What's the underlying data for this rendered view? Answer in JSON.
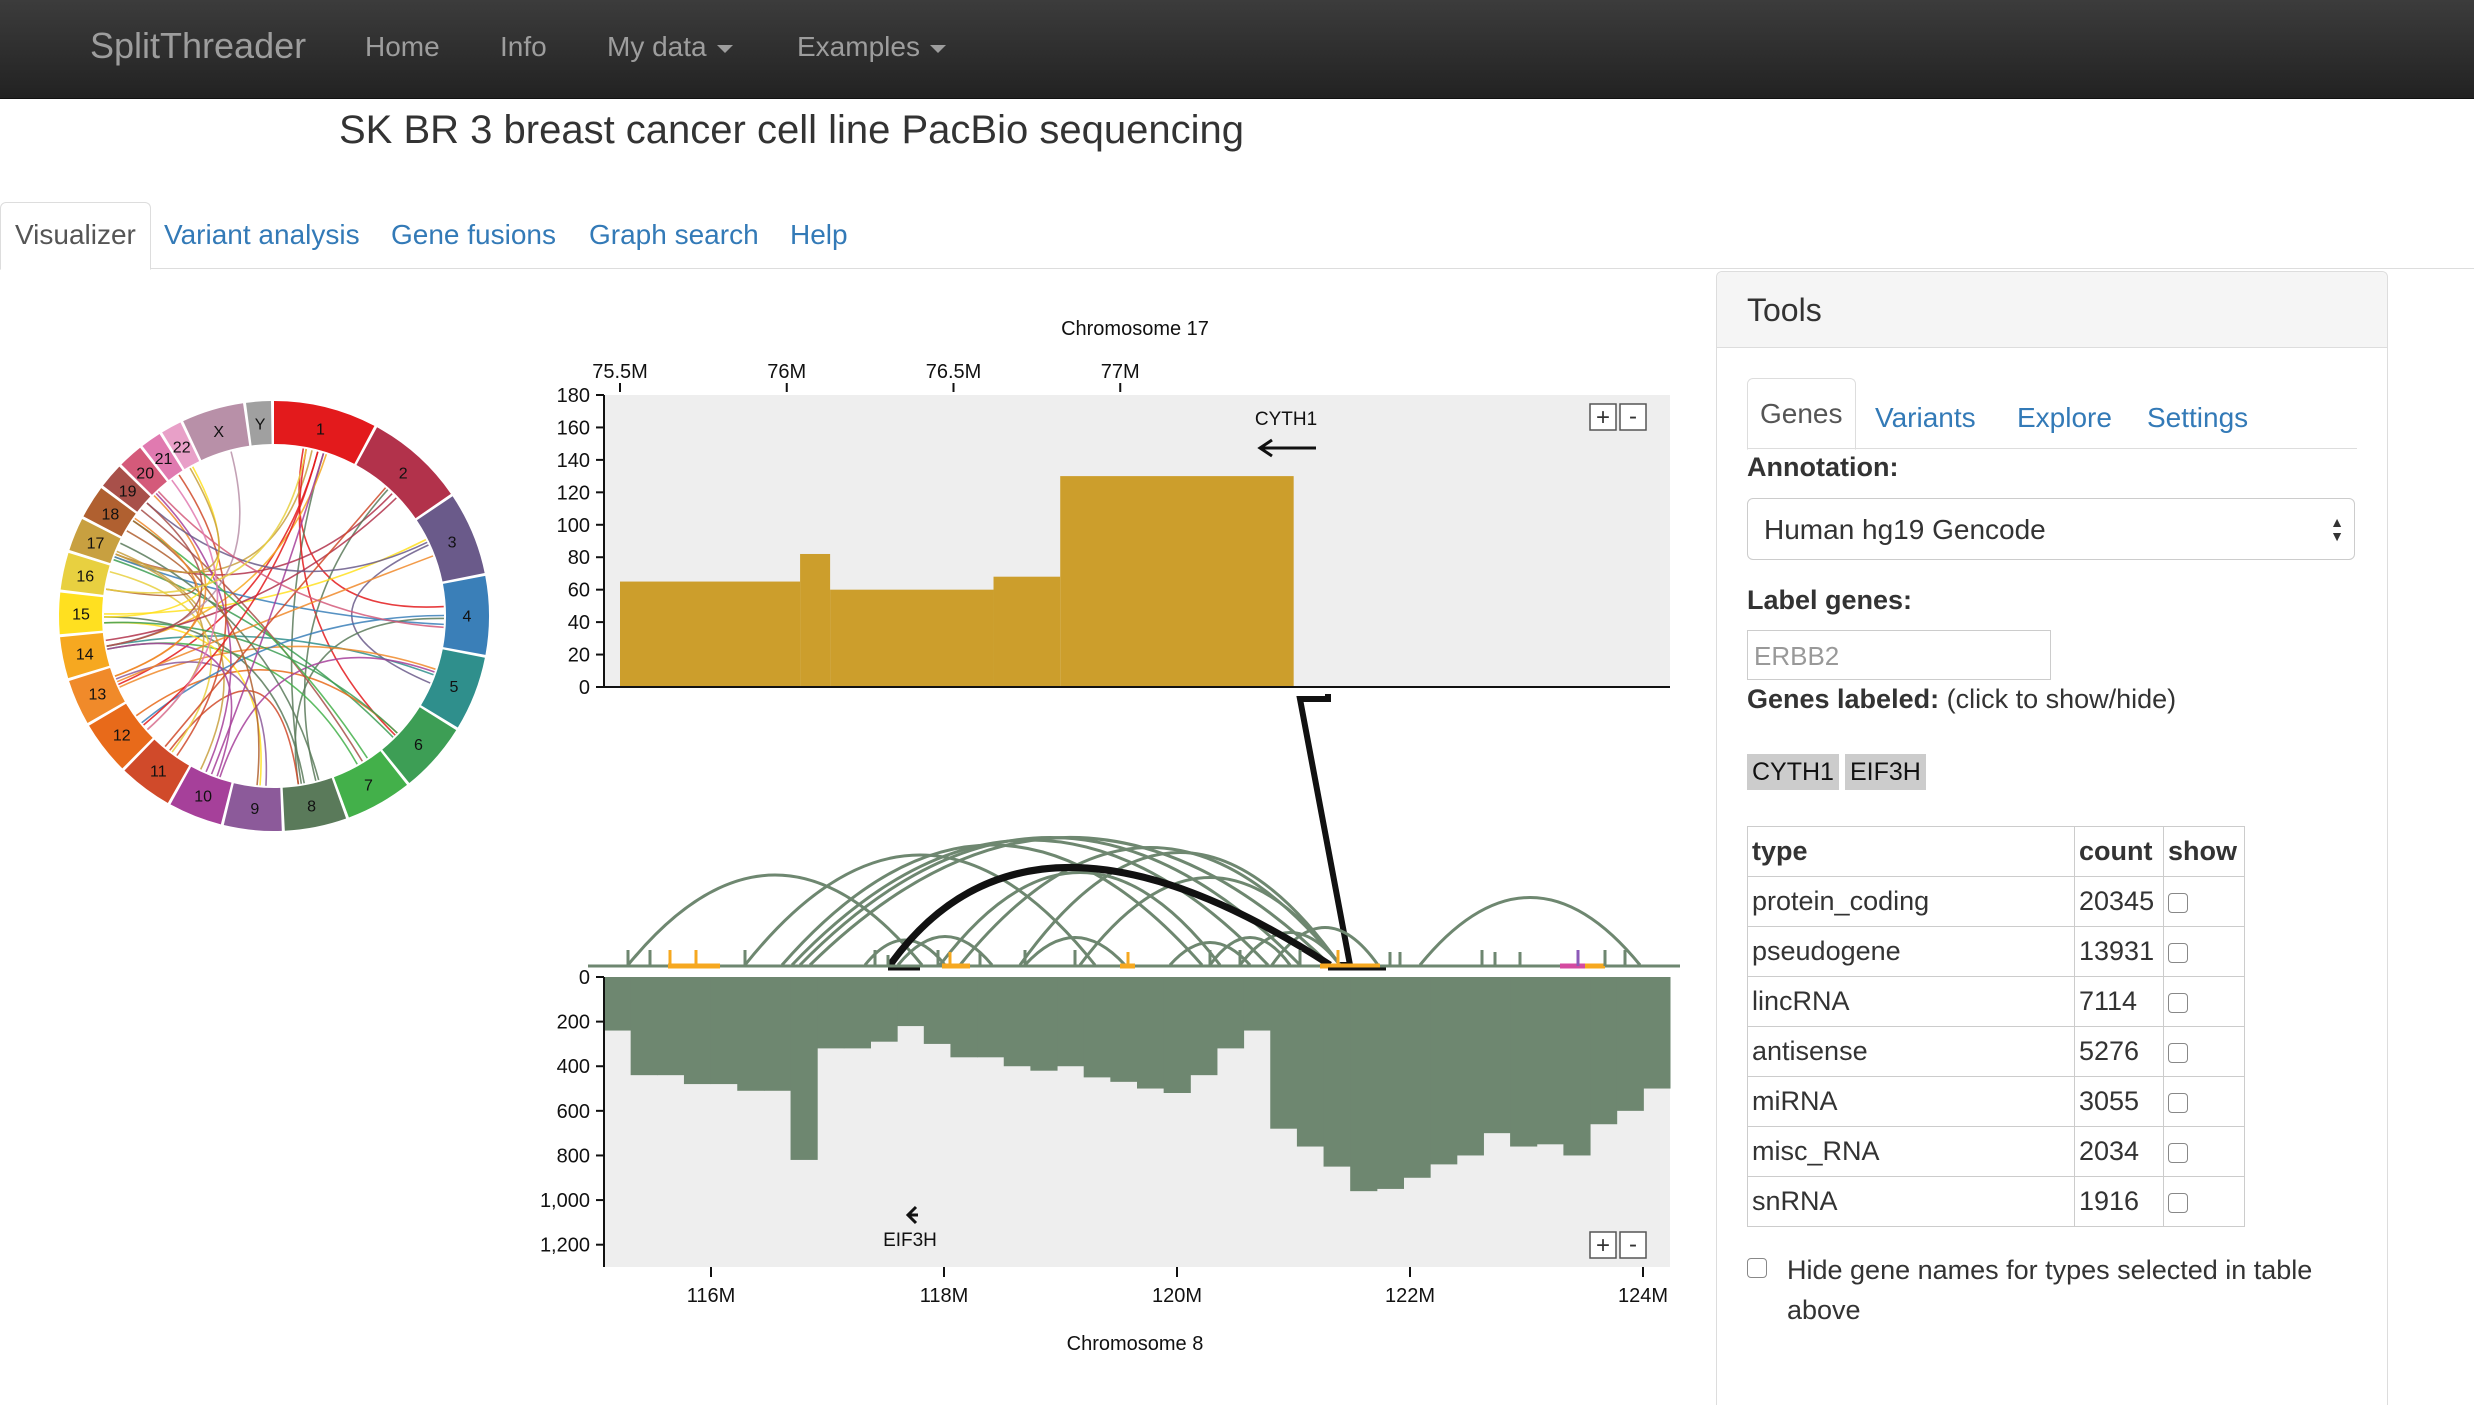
{
  "navbar": {
    "brand": "SplitThreader",
    "items": [
      {
        "label": "Home",
        "dropdown": false
      },
      {
        "label": "Info",
        "dropdown": false
      },
      {
        "label": "My data",
        "dropdown": true
      },
      {
        "label": "Examples",
        "dropdown": true
      }
    ]
  },
  "page_title": "SK BR 3 breast cancer cell line PacBio sequencing",
  "tabs": [
    {
      "label": "Visualizer",
      "active": true
    },
    {
      "label": "Variant analysis",
      "active": false
    },
    {
      "label": "Gene fusions",
      "active": false
    },
    {
      "label": "Graph search",
      "active": false
    },
    {
      "label": "Help",
      "active": false
    }
  ],
  "circos": {
    "chromosomes": [
      {
        "name": "1",
        "color": "#e31a1c"
      },
      {
        "name": "2",
        "color": "#b2324b"
      },
      {
        "name": "3",
        "color": "#6a5a8a"
      },
      {
        "name": "4",
        "color": "#3a7fb8"
      },
      {
        "name": "5",
        "color": "#2f8f8c"
      },
      {
        "name": "6",
        "color": "#3d9e55"
      },
      {
        "name": "7",
        "color": "#43b04a"
      },
      {
        "name": "8",
        "color": "#5a7a5a"
      },
      {
        "name": "9",
        "color": "#8c5a9a"
      },
      {
        "name": "10",
        "color": "#a6409a"
      },
      {
        "name": "11",
        "color": "#d04a2a"
      },
      {
        "name": "12",
        "color": "#e86a1a"
      },
      {
        "name": "13",
        "color": "#f08a2a"
      },
      {
        "name": "14",
        "color": "#f6a820"
      },
      {
        "name": "15",
        "color": "#ffe020"
      },
      {
        "name": "16",
        "color": "#e8d040"
      },
      {
        "name": "17",
        "color": "#c8a040"
      },
      {
        "name": "18",
        "color": "#b06030"
      },
      {
        "name": "19",
        "color": "#a8504a"
      },
      {
        "name": "20",
        "color": "#d45a7a"
      },
      {
        "name": "21",
        "color": "#e07ab0"
      },
      {
        "name": "22",
        "color": "#e8a0c8"
      },
      {
        "name": "X",
        "color": "#b890a8"
      },
      {
        "name": "Y",
        "color": "#a0a0a0"
      }
    ]
  },
  "top_track": {
    "title": "Chromosome 17",
    "ticks": [
      "75.5M",
      "76M",
      "76.5M",
      "77M"
    ],
    "y_ticks": [
      "0",
      "20",
      "40",
      "60",
      "80",
      "100",
      "120",
      "140",
      "160",
      "180"
    ],
    "gene_label": "CYTH1",
    "color": "#cc9e2c",
    "coverage": [
      {
        "x0": 75.5,
        "x1": 76.04,
        "y": 65
      },
      {
        "x0": 76.04,
        "x1": 76.13,
        "y": 82
      },
      {
        "x0": 76.13,
        "x1": 76.62,
        "y": 60
      },
      {
        "x0": 76.62,
        "x1": 76.82,
        "y": 68
      },
      {
        "x0": 76.82,
        "x1": 77.52,
        "y": 130
      }
    ]
  },
  "bottom_track": {
    "title": "Chromosome 8",
    "ticks": [
      "116M",
      "118M",
      "120M",
      "122M",
      "124M"
    ],
    "y_ticks": [
      "0",
      "200",
      "400",
      "600",
      "800",
      "1,000",
      "1,200"
    ],
    "gene_label": "EIF3H",
    "color": "#6e8770",
    "coverage_depths": [
      240,
      440,
      440,
      480,
      480,
      510,
      510,
      820,
      320,
      320,
      290,
      220,
      300,
      360,
      360,
      400,
      420,
      400,
      450,
      470,
      500,
      520,
      440,
      320,
      240,
      680,
      760,
      850,
      960,
      950,
      900,
      840,
      800,
      700,
      760,
      750,
      800,
      660,
      600,
      500
    ]
  },
  "tools": {
    "title": "Tools",
    "subtabs": [
      {
        "label": "Genes",
        "active": true
      },
      {
        "label": "Variants",
        "active": false
      },
      {
        "label": "Explore",
        "active": false
      },
      {
        "label": "Settings",
        "active": false
      }
    ],
    "annotation_label": "Annotation:",
    "annotation_value": "Human hg19 Gencode",
    "label_genes_label": "Label genes:",
    "label_genes_placeholder": "ERBB2",
    "genes_labeled_label": "Genes labeled:",
    "genes_labeled_hint": "(click to show/hide)",
    "gene_chips": [
      "CYTH1",
      "EIF3H"
    ],
    "table": {
      "headers": [
        "type",
        "count",
        "show"
      ],
      "rows": [
        {
          "type": "protein_coding",
          "count": "20345"
        },
        {
          "type": "pseudogene",
          "count": "13931"
        },
        {
          "type": "lincRNA",
          "count": "7114"
        },
        {
          "type": "antisense",
          "count": "5276"
        },
        {
          "type": "miRNA",
          "count": "3055"
        },
        {
          "type": "misc_RNA",
          "count": "2034"
        },
        {
          "type": "snRNA",
          "count": "1916"
        }
      ]
    },
    "hide_gene_names_label": "Hide gene names for types selected in table above"
  }
}
